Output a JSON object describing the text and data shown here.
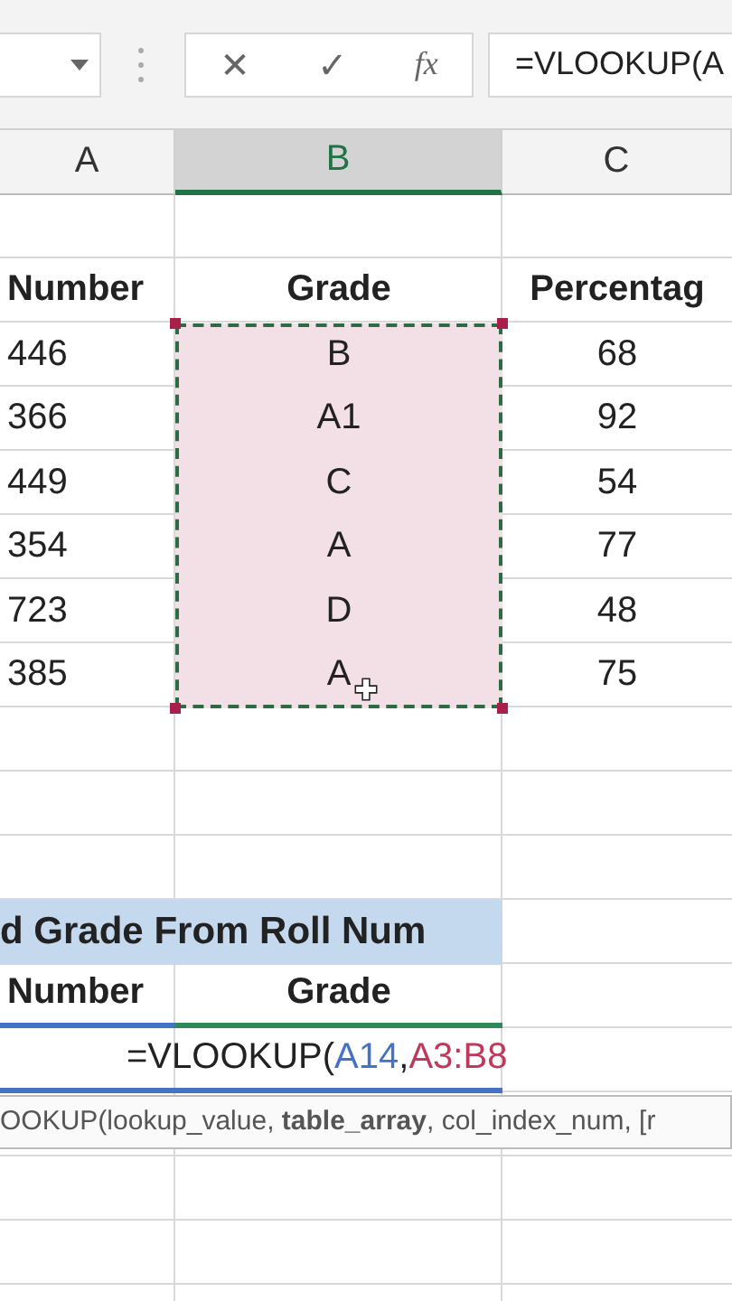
{
  "formula_bar": {
    "value": "=VLOOKUP(A",
    "cancel": "✕",
    "enter": "✓",
    "function": "fx"
  },
  "columns": [
    {
      "label": "A",
      "selected": false
    },
    {
      "label": "B",
      "selected": true
    },
    {
      "label": "C",
      "selected": false
    }
  ],
  "table_header": [
    "Number",
    "Grade",
    "Percentag"
  ],
  "rows": [
    {
      "number": "446",
      "grade": "B",
      "percentage": "68",
      "grade_selected": true
    },
    {
      "number": "366",
      "grade": "A1",
      "percentage": "92",
      "grade_selected": true
    },
    {
      "number": "449",
      "grade": "C",
      "percentage": "54",
      "grade_selected": true
    },
    {
      "number": "354",
      "grade": "A",
      "percentage": "77",
      "grade_selected": true
    },
    {
      "number": "723",
      "grade": "D",
      "percentage": "48",
      "grade_selected": true
    },
    {
      "number": "385",
      "grade": "A",
      "percentage": "75",
      "grade_selected": true
    }
  ],
  "lookup": {
    "title": "d Grade From Roll Num",
    "headers": [
      "Number",
      "Grade"
    ],
    "formula_parts": [
      {
        "text": "=VLOOKUP(",
        "color": "#222222"
      },
      {
        "text": "A14",
        "color": "#4472c4"
      },
      {
        "text": ",",
        "color": "#222222"
      },
      {
        "text": "A3:B8",
        "color": "#c0395a"
      }
    ],
    "tooltip": "OOKUP(lookup_value, **table_array**, col_index_num, [r"
  }
}
